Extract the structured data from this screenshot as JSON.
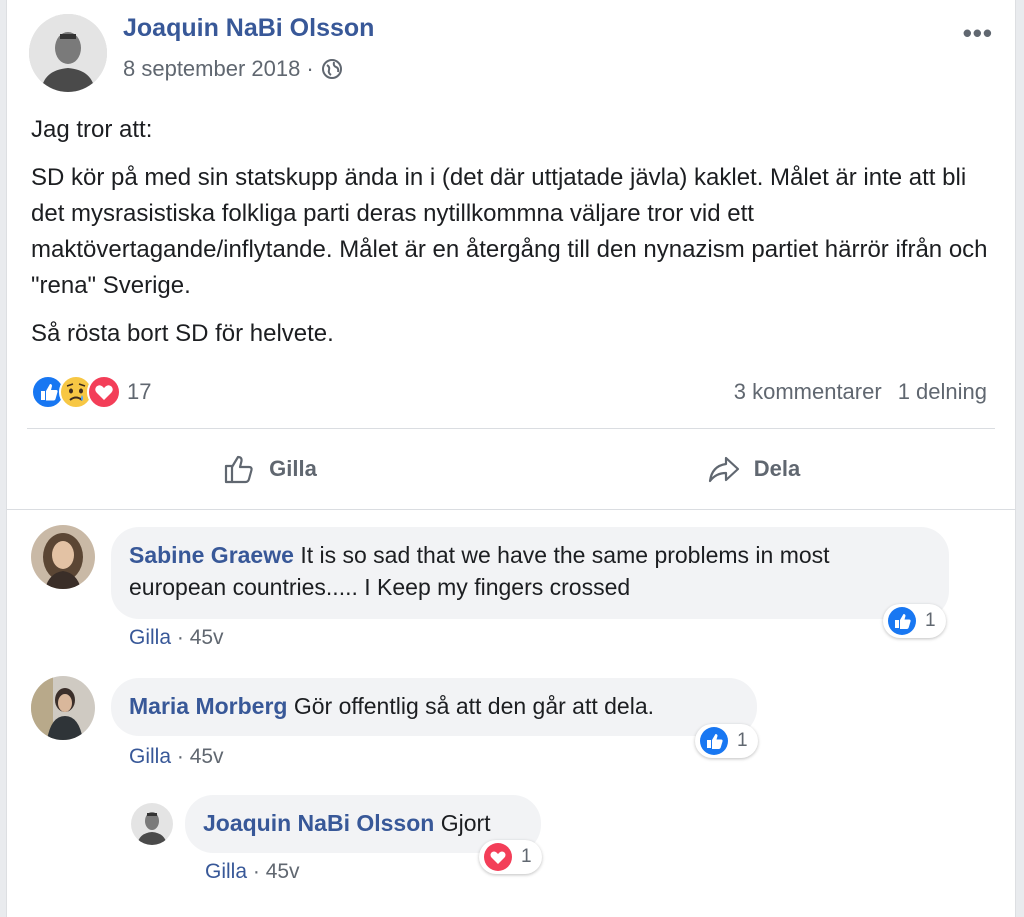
{
  "post": {
    "author": "Joaquin NaBi Olsson",
    "date": "8 september 2018",
    "date_separator": "·",
    "more_label": "•••",
    "paragraphs": [
      "Jag tror att:",
      "SD kör på med sin statskupp ända in i (det där uttjatade jävla) kaklet. Målet är inte att bli det mysrasistiska folkliga parti deras nytillkommna väljare tror vid ett maktövertagande/inflytande. Målet är en återgång till den nynazism partiet härrör ifrån och \"rena\" Sverige.",
      "Så rösta bort SD för helvete."
    ],
    "reactions": {
      "icons": [
        "like-icon",
        "sad-icon",
        "love-icon"
      ],
      "count": "17",
      "comments": "3 kommentarer",
      "shares": "1 delning"
    },
    "actions": {
      "like": "Gilla",
      "share": "Dela"
    }
  },
  "comments": [
    {
      "name": "Sabine Graewe",
      "text": "It is so sad that we have the same problems in most european countries..... I Keep my fingers crossed",
      "like": "Gilla",
      "sep": "·",
      "time": "45v",
      "reaction_icon": "like-icon",
      "reaction_count": "1"
    },
    {
      "name": "Maria Morberg",
      "text": "Gör offentlig så att den går att dela.",
      "like": "Gilla",
      "sep": "·",
      "time": "45v",
      "reaction_icon": "like-icon",
      "reaction_count": "1"
    },
    {
      "name": "Joaquin NaBi Olsson",
      "text": "Gjort",
      "like": "Gilla",
      "sep": "·",
      "time": "45v",
      "reaction_icon": "love-icon",
      "reaction_count": "1"
    }
  ],
  "colors": {
    "link": "#385898",
    "muted": "#606770",
    "like_blue": "#1877f2",
    "love_red": "#f33e58",
    "bubble_bg": "#f2f3f5"
  }
}
